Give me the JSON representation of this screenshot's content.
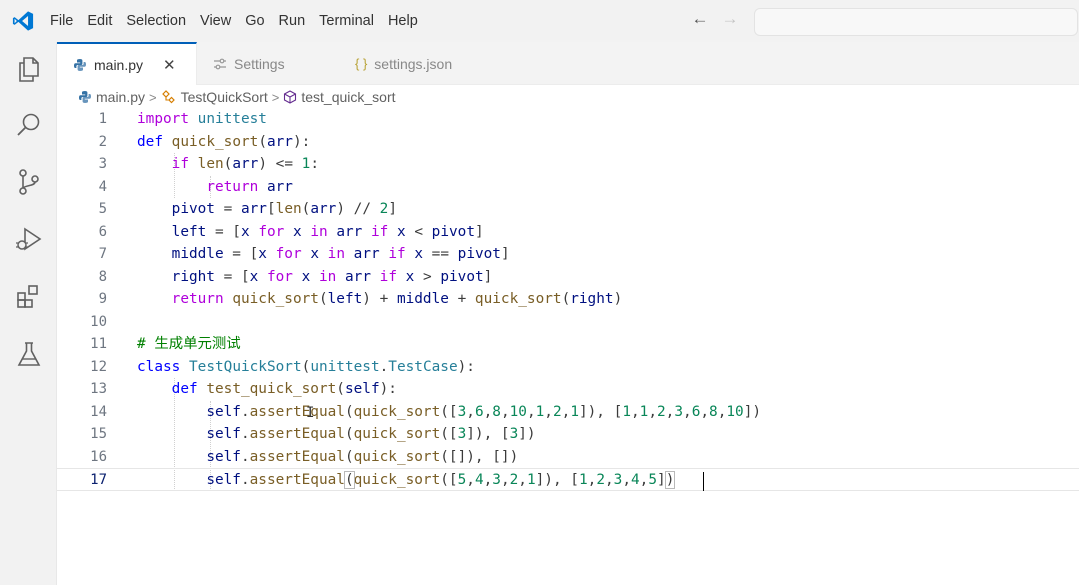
{
  "menu": {
    "items": [
      "File",
      "Edit",
      "Selection",
      "View",
      "Go",
      "Run",
      "Terminal",
      "Help"
    ]
  },
  "nav": {
    "back": "←",
    "forward": "→"
  },
  "tabs": [
    {
      "label": "main.py",
      "icon": "python-icon",
      "active": true,
      "close": "✕"
    },
    {
      "label": "Settings",
      "icon": "settings-icon",
      "active": false
    },
    {
      "label": "settings.json",
      "icon": "json-braces-icon",
      "active": false,
      "icon_text": "{ }"
    }
  ],
  "breadcrumb": {
    "file": "main.py",
    "class": "TestQuickSort",
    "method": "test_quick_sort",
    "sep": ">"
  },
  "editor": {
    "current_line": 17,
    "lines": [
      {
        "n": "1",
        "text": "import unittest"
      },
      {
        "n": "2",
        "text": "def quick_sort(arr):"
      },
      {
        "n": "3",
        "text": "    if len(arr) <= 1:"
      },
      {
        "n": "4",
        "text": "        return arr"
      },
      {
        "n": "5",
        "text": "    pivot = arr[len(arr) // 2]"
      },
      {
        "n": "6",
        "text": "    left = [x for x in arr if x < pivot]"
      },
      {
        "n": "7",
        "text": "    middle = [x for x in arr if x == pivot]"
      },
      {
        "n": "8",
        "text": "    right = [x for x in arr if x > pivot]"
      },
      {
        "n": "9",
        "text": "    return quick_sort(left) + middle + quick_sort(right)"
      },
      {
        "n": "10",
        "text": ""
      },
      {
        "n": "11",
        "text": "# 生成单元测试"
      },
      {
        "n": "12",
        "text": "class TestQuickSort(unittest.TestCase):"
      },
      {
        "n": "13",
        "text": "    def test_quick_sort(self):"
      },
      {
        "n": "14",
        "text": "        self.assertEqual(quick_sort([3,6,8,10,1,2,1]), [1,1,2,3,6,8,10])"
      },
      {
        "n": "15",
        "text": "        self.assertEqual(quick_sort([3]), [3])"
      },
      {
        "n": "16",
        "text": "        self.assertEqual(quick_sort([]), [])"
      },
      {
        "n": "17",
        "text": "        self.assertEqual(quick_sort([5,4,3,2,1]), [1,2,3,4,5])"
      }
    ]
  },
  "colors": {
    "keyword": "#0000ff",
    "control": "#af00db",
    "function": "#795e26",
    "class": "#267f99",
    "variable": "#001080",
    "number": "#098658",
    "comment": "#008000",
    "accent": "#005fb8"
  }
}
